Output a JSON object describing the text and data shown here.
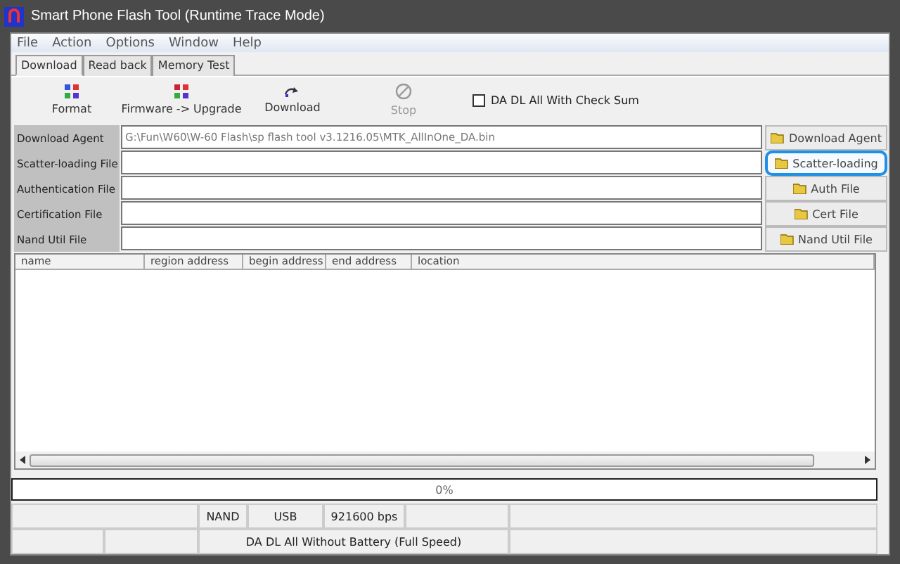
{
  "window": {
    "title": "Smart Phone Flash Tool (Runtime Trace Mode)"
  },
  "menu": [
    "File",
    "Action",
    "Options",
    "Window",
    "Help"
  ],
  "tabs": [
    {
      "label": "Download",
      "selected": true
    },
    {
      "label": "Read back",
      "selected": false
    },
    {
      "label": "Memory Test",
      "selected": false
    }
  ],
  "toolbar": [
    {
      "label": "Format",
      "kind": "format",
      "disabled": false
    },
    {
      "label": "Firmware -> Upgrade",
      "kind": "firmware",
      "disabled": false
    },
    {
      "label": "Download",
      "kind": "download",
      "disabled": false
    },
    {
      "label": "Stop",
      "kind": "stop",
      "disabled": true
    }
  ],
  "checksum": {
    "label": "DA DL All With Check Sum",
    "checked": false
  },
  "files": [
    {
      "label": "Download Agent",
      "value": "G:\\Fun\\W60\\W-60 Flash\\sp flash tool v3.1216.05\\MTK_AllInOne_DA.bin",
      "button": "Download Agent",
      "highlighted": false
    },
    {
      "label": "Scatter-loading File",
      "button": "Scatter-loading",
      "highlighted": true
    },
    {
      "label": "Authentication File",
      "button": "Auth File",
      "highlighted": false
    },
    {
      "label": "Certification File",
      "button": "Cert File",
      "highlighted": false
    },
    {
      "label": "Nand Util File",
      "button": "Nand Util File",
      "highlighted": false
    }
  ],
  "table": {
    "columns": [
      "name",
      "region address",
      "begin address",
      "end address",
      "location"
    ]
  },
  "progress": {
    "label": "0%",
    "level": 0
  },
  "status_bar": [
    [
      "NAND",
      "USB",
      "921600 bps"
    ],
    [
      "DA DL All Without Battery (Full Speed)"
    ]
  ]
}
